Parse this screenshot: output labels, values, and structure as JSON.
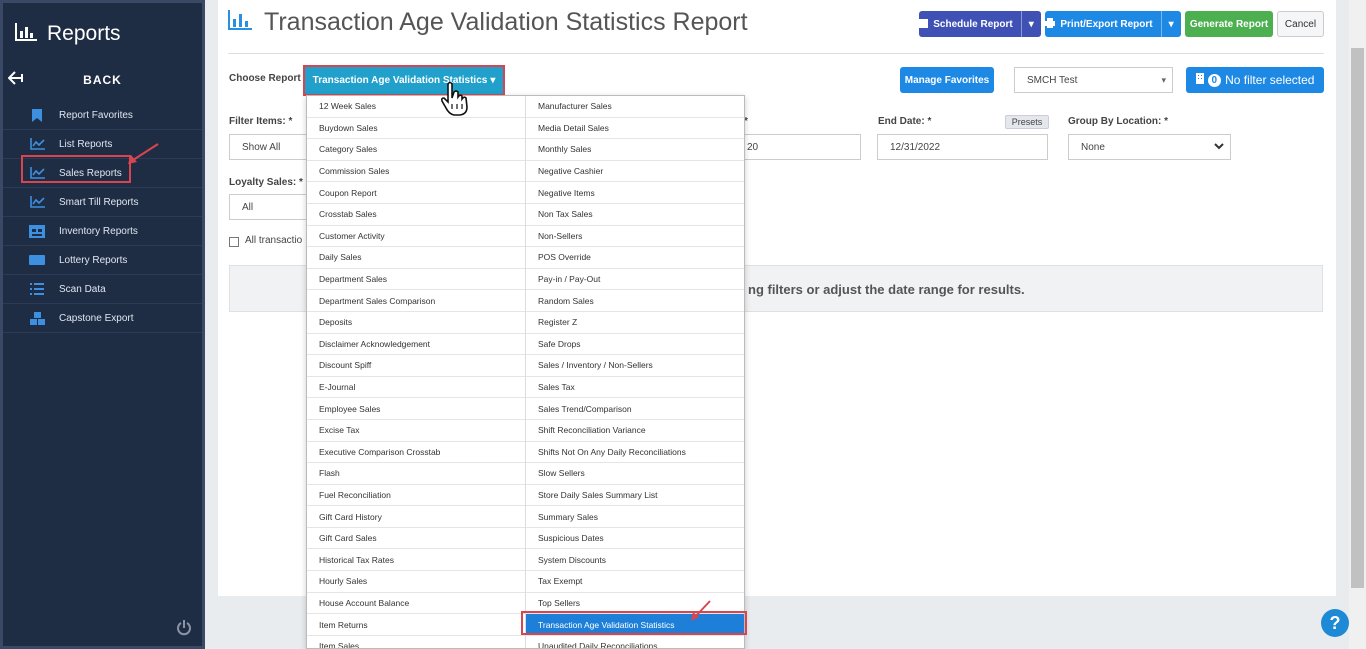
{
  "sidebar": {
    "title": "Reports",
    "back_label": "BACK",
    "items": [
      {
        "label": "Report Favorites",
        "icon": "bookmark-icon"
      },
      {
        "label": "List Reports",
        "icon": "chart-line-icon"
      },
      {
        "label": "Sales Reports",
        "icon": "chart-line-icon"
      },
      {
        "label": "Smart Till Reports",
        "icon": "chart-line-icon"
      },
      {
        "label": "Inventory Reports",
        "icon": "warehouse-icon"
      },
      {
        "label": "Lottery Reports",
        "icon": "ticket-icon"
      },
      {
        "label": "Scan Data",
        "icon": "list-icon"
      },
      {
        "label": "Capstone Export",
        "icon": "cubes-icon"
      }
    ]
  },
  "header": {
    "title": "Transaction Age Validation Statistics Report",
    "schedule_label": "Schedule Report",
    "print_label": "Print/Export Report",
    "generate_label": "Generate Report",
    "cancel_label": "Cancel"
  },
  "choose": {
    "label": "Choose Report",
    "selected": "Transaction Age Validation Statistics",
    "manage_favorites": "Manage Favorites",
    "store": "SMCH Test",
    "filter_count": "0",
    "filter_text": "No filter selected"
  },
  "filters": {
    "filter_items_label": "Filter Items: *",
    "filter_items_value": "Show All",
    "start_date_partial_label": "*",
    "start_date_partial_value": "20",
    "end_date_label": "End Date: *",
    "end_date_value": "12/31/2022",
    "presets_label": "Presets",
    "group_by_label": "Group By Location: *",
    "group_by_value": "None",
    "loyalty_label": "Loyalty Sales: *",
    "loyalty_value": "All",
    "all_transactions_partial": "All transactio",
    "message_partial": "ng filters or adjust the date range for results."
  },
  "dropdown": {
    "col1": [
      "12 Week Sales",
      "Buydown Sales",
      "Category Sales",
      "Commission Sales",
      "Coupon Report",
      "Crosstab Sales",
      "Customer Activity",
      "Daily Sales",
      "Department Sales",
      "Department Sales Comparison",
      "Deposits",
      "Disclaimer Acknowledgement",
      "Discount Spiff",
      "E-Journal",
      "Employee Sales",
      "Excise Tax",
      "Executive Comparison Crosstab",
      "Flash",
      "Fuel Reconciliation",
      "Gift Card History",
      "Gift Card Sales",
      "Historical Tax Rates",
      "Hourly Sales",
      "House Account Balance",
      "Item Returns",
      "Item Sales"
    ],
    "col2": [
      "Manufacturer Sales",
      "Media Detail Sales",
      "Monthly Sales",
      "Negative Cashier",
      "Negative Items",
      "Non Tax Sales",
      "Non-Sellers",
      "POS Override",
      "Pay-in / Pay-Out",
      "Random Sales",
      "Register Z",
      "Safe Drops",
      "Sales / Inventory / Non-Sellers",
      "Sales Tax",
      "Sales Trend/Comparison",
      "Shift Reconciliation Variance",
      "Shifts Not On Any Daily Reconciliations",
      "Slow Sellers",
      "Store Daily Sales Summary List",
      "Summary Sales",
      "Suspicious Dates",
      "System Discounts",
      "Tax Exempt",
      "Top Sellers",
      "Transaction Age Validation Statistics",
      "Unaudited Daily Reconciliations"
    ]
  },
  "colors": {
    "sidebar_bg": "#1f2d44",
    "accent_blue": "#1e7fd8",
    "generate_green": "#4caf50",
    "schedule_indigo": "#3f51b5",
    "highlight_red": "#d9454f"
  }
}
